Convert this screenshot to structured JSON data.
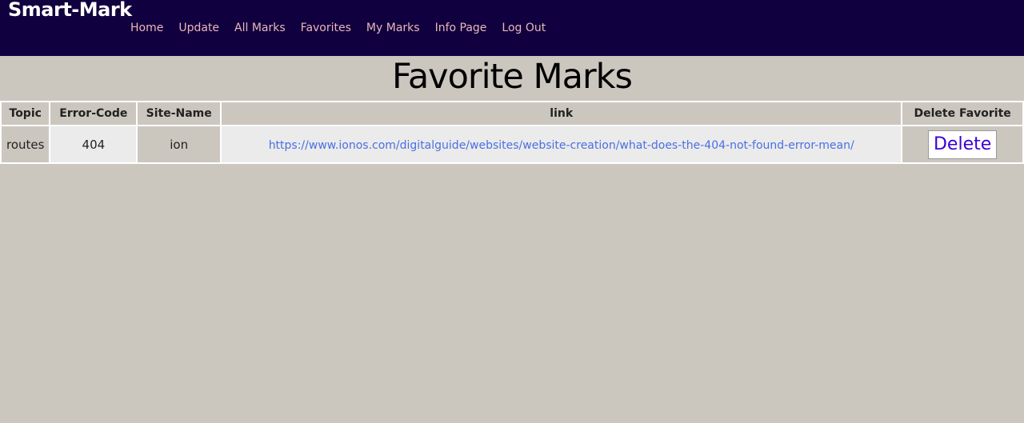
{
  "brand": "Smart-Mark",
  "nav": [
    "Home",
    "Update",
    "All Marks",
    "Favorites",
    "My Marks",
    "Info Page",
    "Log Out"
  ],
  "page_title": "Favorite Marks",
  "table": {
    "headers": [
      "Topic",
      "Error-Code",
      "Site-Name",
      "link",
      "Delete Favorite"
    ],
    "rows": [
      {
        "topic": "routes",
        "error_code": "404",
        "site_name": "ion",
        "link": "https://www.ionos.com/digitalguide/websites/website-creation/what-does-the-404-not-found-error-mean/",
        "delete_label": "Delete"
      }
    ]
  },
  "colors": {
    "navbar": "#11003f",
    "page_bg": "#cbc7bf",
    "nav_link": "#e8b8b8",
    "link": "#4a6fe3",
    "delete_text": "#3a00d6"
  }
}
